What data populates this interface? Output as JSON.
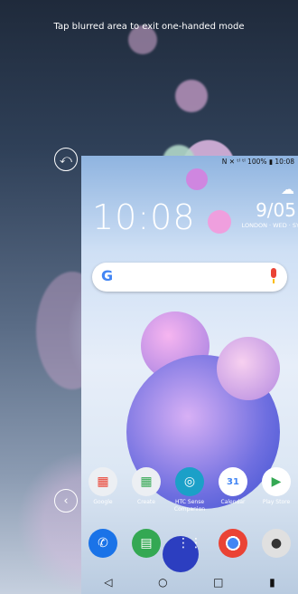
{
  "overlay": {
    "tip_text": "Tap blurred area to exit one-handed mode"
  },
  "mini_screen": {
    "status": "N ✕ ᵗˡ ᵗˡ 100% ▮ 10:08",
    "clock": "10:08",
    "date": "9/05",
    "location": "LONDON · WED · SY",
    "apps": [
      {
        "label": "Google",
        "icon": "google-folder-icon"
      },
      {
        "label": "Create",
        "icon": "create-folder-icon"
      },
      {
        "label": "HTC Sense Companion",
        "icon": "htc-sense-companion-icon"
      },
      {
        "label": "Calendar",
        "icon": "calendar-icon"
      },
      {
        "label": "Play Store",
        "icon": "play-store-icon"
      }
    ],
    "calendar_day": "31",
    "dock": [
      "phone-icon",
      "messages-icon",
      "apps-drawer-icon",
      "chrome-icon",
      "camera-icon"
    ],
    "nav": [
      "◁",
      "○",
      "□",
      "▮"
    ]
  },
  "colors": {
    "google_blue": "#4285f4",
    "google_red": "#ea4335",
    "google_yellow": "#fbbc05",
    "google_green": "#34a853"
  }
}
